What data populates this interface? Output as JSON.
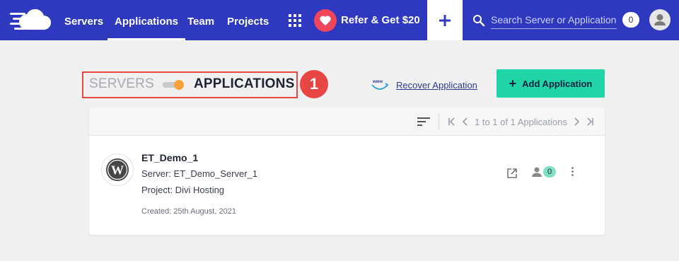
{
  "nav": {
    "items": [
      {
        "label": "Servers"
      },
      {
        "label": "Applications",
        "active": true
      },
      {
        "label": "Team"
      },
      {
        "label": "Projects"
      }
    ],
    "refer_label": "Refer & Get $20",
    "search_placeholder": "Search Server or Application",
    "notification_count": "0"
  },
  "toggle": {
    "servers_label": "SERVERS",
    "applications_label": "APPLICATIONS",
    "selected": "APPLICATIONS",
    "step_number": "1"
  },
  "actions": {
    "recover_label": "Recover Application",
    "add_label": "Add Application"
  },
  "pager": {
    "text": "1 to 1 of 1 Applications"
  },
  "application": {
    "name": "ET_Demo_1",
    "server": "Server: ET_Demo_Server_1",
    "project": "Project: Divi Hosting",
    "created": "Created: 25th August, 2021",
    "member_count": "0"
  },
  "colors": {
    "nav_bg": "#2f39bf",
    "accent": "#1fd4a6",
    "highlight": "#e84545",
    "toggle_knob": "#f5a23a"
  },
  "icons": [
    "cloud-logo-icon",
    "apps-grid-icon",
    "heart-icon",
    "plus-icon",
    "search-icon",
    "user-avatar-icon",
    "www-icon",
    "sort-icon",
    "first-page-icon",
    "prev-page-icon",
    "next-page-icon",
    "last-page-icon",
    "wordpress-icon",
    "external-link-icon",
    "members-icon",
    "more-vert-icon"
  ]
}
